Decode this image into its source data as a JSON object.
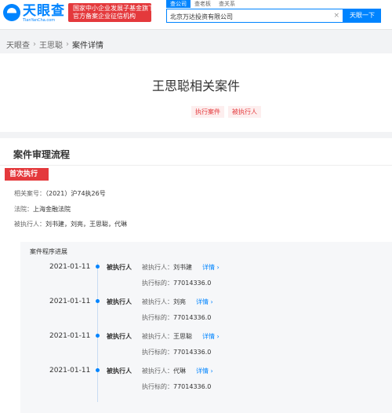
{
  "header": {
    "logo_cn": "天眼查",
    "logo_en": "TianYanCha.com",
    "badge_line1": "国家中小企业发展子基金旗下",
    "badge_line2": "官方备案企业征信机构",
    "tabs": [
      {
        "label": "查公司",
        "active": true
      },
      {
        "label": "查老板",
        "active": false
      },
      {
        "label": "查关系",
        "active": false
      }
    ],
    "search_value": "北京万达投资有限公司",
    "search_button": "天眼一下",
    "brand_color": "#0084ff"
  },
  "breadcrumb": [
    "天眼查",
    "王思聪",
    "案件详情"
  ],
  "case": {
    "title": "王思聪相关案件",
    "tags": [
      "执行案件",
      "被执行人"
    ]
  },
  "process": {
    "section_title": "案件审理流程",
    "stage_badge": "首次执行",
    "case_no_label": "相关案号：",
    "case_no": "（2021）沪74执26号",
    "court_label": "法院：",
    "court": "上海金融法院",
    "executed_label": "被执行人：",
    "executed": "刘书建，刘亮，王思聪，代琳",
    "progress_title": "案件程序进展",
    "entries": [
      {
        "date": "2021-01-11",
        "type": "被执行人",
        "person_label": "被执行人：",
        "person": "刘书建",
        "link": "详情 ›",
        "amount_label": "执行标的：",
        "amount": "77014336.0"
      },
      {
        "date": "2021-01-11",
        "type": "被执行人",
        "person_label": "被执行人：",
        "person": "刘亮",
        "link": "详情 ›",
        "amount_label": "执行标的：",
        "amount": "77014336.0"
      },
      {
        "date": "2021-01-11",
        "type": "被执行人",
        "person_label": "被执行人：",
        "person": "王思聪",
        "link": "详情 ›",
        "amount_label": "执行标的：",
        "amount": "77014336.0"
      },
      {
        "date": "2021-01-11",
        "type": "被执行人",
        "person_label": "被执行人：",
        "person": "代琳",
        "link": "详情 ›",
        "amount_label": "执行标的：",
        "amount": "77014336.0"
      }
    ]
  }
}
